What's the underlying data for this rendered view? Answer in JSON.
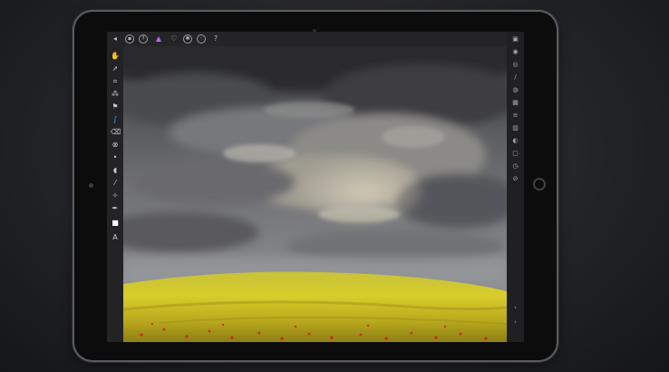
{
  "app": {
    "device": "tablet",
    "screen_content": "photo-editing canvas with storm clouds over a yellow flower meadow"
  },
  "top_toolbar": {
    "icons": [
      "menu-icon",
      "document-icon",
      "export-icon",
      "persona-triangle-icon",
      "heart-icon",
      "settings-icon",
      "globe-icon",
      "help-icon"
    ],
    "help_glyph": "?"
  },
  "left_tools": {
    "icons": [
      "hand-icon",
      "move-icon",
      "crop-icon",
      "selection-brush-icon",
      "flood-select-icon",
      "paint-brush-icon",
      "erase-icon",
      "clone-icon",
      "blur-brush-icon",
      "dodge-icon",
      "healing-icon",
      "retouch-icon",
      "pen-icon",
      "shape-icon",
      "text-icon"
    ]
  },
  "right_studio": {
    "icons": [
      "layers-icon",
      "adjustments-icon",
      "effects-icon",
      "brushes-icon",
      "color-icon",
      "swatches-icon",
      "channels-icon",
      "histogram-icon",
      "navigator-icon",
      "transform-icon",
      "history-icon",
      "styles-icon",
      "undo-icon",
      "redo-icon"
    ]
  },
  "colors": {
    "accent_blue": "#59a8e8",
    "accent_purple": "#c060f0",
    "toolbar_bg": "#242426"
  }
}
